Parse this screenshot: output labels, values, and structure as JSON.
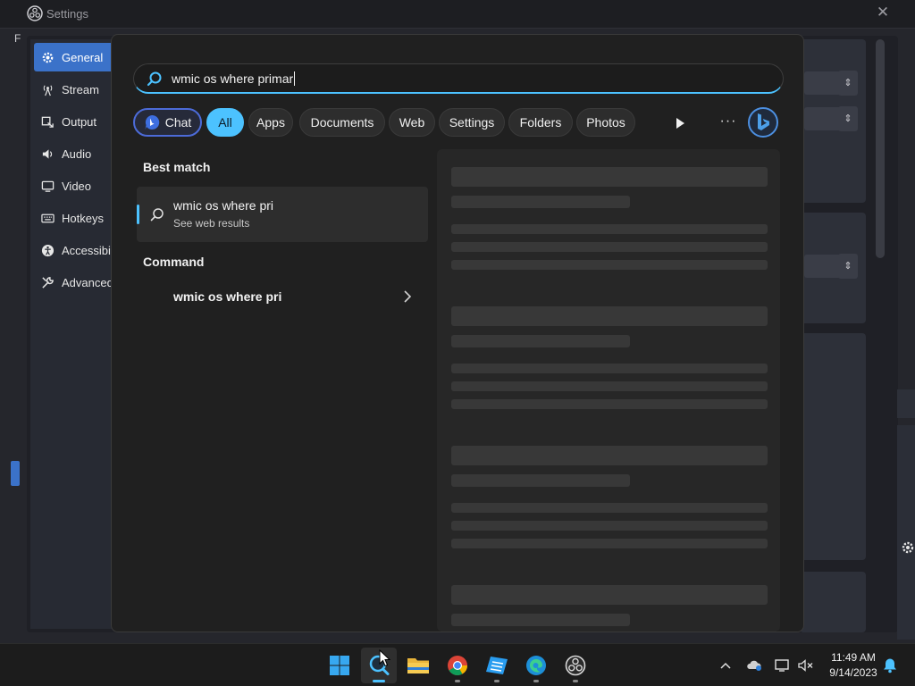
{
  "settings_window": {
    "title": "Settings",
    "close_glyph": "✕",
    "menu_letter": "F",
    "sidebar": [
      {
        "label": "General",
        "icon": "gear-icon",
        "active": true
      },
      {
        "label": "Stream",
        "icon": "antenna-icon"
      },
      {
        "label": "Output",
        "icon": "output-icon"
      },
      {
        "label": "Audio",
        "icon": "speaker-icon"
      },
      {
        "label": "Video",
        "icon": "monitor-icon"
      },
      {
        "label": "Hotkeys",
        "icon": "keyboard-icon"
      },
      {
        "label": "Accessibil",
        "icon": "accessibility-icon"
      },
      {
        "label": "Advanced",
        "icon": "wrench-icon"
      }
    ]
  },
  "search": {
    "query": "wmic os where primar",
    "filters": [
      {
        "label": "Chat",
        "icon": "bing-chat-icon"
      },
      {
        "label": "All",
        "active": true
      },
      {
        "label": "Apps"
      },
      {
        "label": "Documents"
      },
      {
        "label": "Web"
      },
      {
        "label": "Settings"
      },
      {
        "label": "Folders"
      },
      {
        "label": "Photos"
      }
    ],
    "more_glyph": "···",
    "best_match": {
      "heading": "Best match",
      "title": "wmic os where pri",
      "subtitle": "See web results",
      "icon": "search-icon"
    },
    "command": {
      "heading": "Command",
      "label": "wmic os where pri",
      "icon": "chevron-right-icon"
    }
  },
  "taskbar": {
    "apps": [
      {
        "name": "start",
        "icon": "windows-logo-icon"
      },
      {
        "name": "search",
        "icon": "search-icon",
        "active": true
      },
      {
        "name": "file-explorer",
        "icon": "folder-icon"
      },
      {
        "name": "chrome",
        "icon": "chrome-icon"
      },
      {
        "name": "roblox-studio",
        "icon": "roblox-studio-icon"
      },
      {
        "name": "edge",
        "icon": "edge-icon"
      },
      {
        "name": "obs",
        "icon": "obs-icon"
      }
    ],
    "clock": {
      "time": "11:49 AM",
      "date": "9/14/2023"
    },
    "tray_icons": [
      "chevron-up-icon",
      "onedrive-icon",
      "network-icon",
      "volume-muted-icon",
      "notification-bell-icon"
    ]
  },
  "colors": {
    "accent": "#4cc2ff",
    "obs_selection": "#3b72c9",
    "flyout_bg": "#202020"
  }
}
